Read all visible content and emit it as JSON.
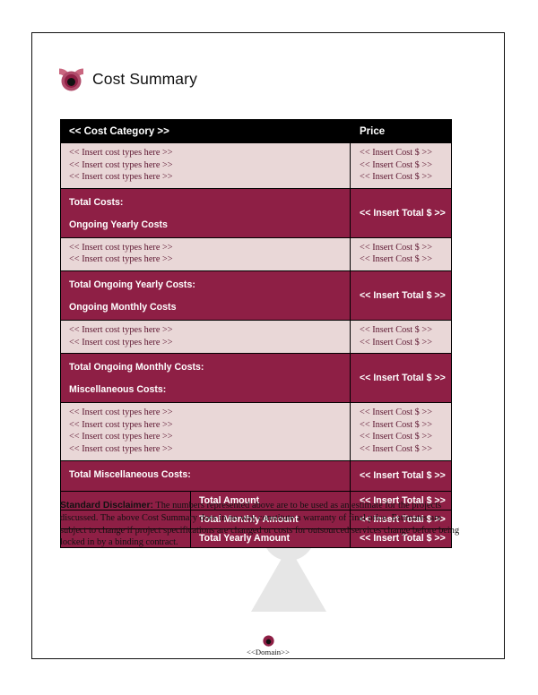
{
  "document": {
    "title": "Cost Summary",
    "logo_icon": "concentric-arcs-logo"
  },
  "colors": {
    "band": "#8E1F45",
    "rows": "#E9D7D7",
    "header": "#000000",
    "item_text": "#5D1630",
    "accent_dark": "#8E1F45",
    "accent_light": "#C9667F",
    "watermark_gray": "#E6E6E6",
    "watermark_pink": "#F4E0E4"
  },
  "table": {
    "header": {
      "category": "<< Cost Category >>",
      "price": "Price"
    },
    "item_placeholder": "<< Insert cost types here >>",
    "cost_placeholder": "<< Insert Cost $ >>",
    "total_placeholder": "<< Insert Total $ >>",
    "sections": [
      {
        "name": "initial-costs",
        "items": [
          {
            "label": "<< Insert cost types here >>",
            "price": "<< Insert Cost $ >>"
          },
          {
            "label": "<< Insert cost types here >>",
            "price": "<< Insert Cost $ >>"
          },
          {
            "label": "<< Insert cost types here >>",
            "price": "<< Insert Cost $ >>"
          }
        ],
        "total_label": "Total Costs:",
        "next_heading": "Ongoing Yearly Costs",
        "total_value": "<< Insert Total $ >>"
      },
      {
        "name": "ongoing-yearly-costs",
        "items": [
          {
            "label": "<< Insert cost types here >>",
            "price": "<< Insert Cost $ >>"
          },
          {
            "label": "<< Insert cost types here >>",
            "price": "<< Insert Cost $ >>"
          }
        ],
        "total_label": "Total Ongoing Yearly Costs:",
        "next_heading": "Ongoing Monthly Costs",
        "total_value": "<< Insert Total $ >>"
      },
      {
        "name": "ongoing-monthly-costs",
        "items": [
          {
            "label": "<< Insert cost types here >>",
            "price": "<< Insert Cost $ >>"
          },
          {
            "label": "<< Insert cost types here >>",
            "price": "<< Insert Cost $ >>"
          }
        ],
        "total_label": "Total Ongoing Monthly Costs:",
        "next_heading": "Miscellaneous Costs:",
        "total_value": "<< Insert Total $ >>"
      },
      {
        "name": "miscellaneous-costs",
        "items": [
          {
            "label": "<< Insert cost types here >>",
            "price": "<< Insert Cost $ >>"
          },
          {
            "label": "<< Insert cost types here >>",
            "price": "<< Insert Cost $ >>"
          },
          {
            "label": "<< Insert cost types here >>",
            "price": "<< Insert Cost $ >>"
          },
          {
            "label": "<< Insert cost types here >>",
            "price": "<< Insert Cost $ >>"
          }
        ],
        "total_label": "Total Miscellaneous Costs:",
        "next_heading": "",
        "total_value": "<< Insert Total $ >>"
      }
    ],
    "summary_rows": [
      {
        "label": "Total Amount",
        "value": "<< Insert Total $ >>"
      },
      {
        "label": "Total Monthly Amount",
        "value": "<< Insert Total $ >>"
      },
      {
        "label": "Total Yearly Amount",
        "value": "<< Insert Total $ >>"
      }
    ]
  },
  "disclaimer": {
    "lead": "Standard Disclaimer:",
    "body": " The numbers represented above are to be used as an estimate for the projects discussed. The above Cost Summary does in no way constitute a warranty of final price.  Estimates are subject to change if project specifications are changed or costs for outsourced services change before being locked in by a binding contract."
  },
  "footer": {
    "domain": "<<Domain>>",
    "logo_icon": "concentric-arcs-logo"
  }
}
